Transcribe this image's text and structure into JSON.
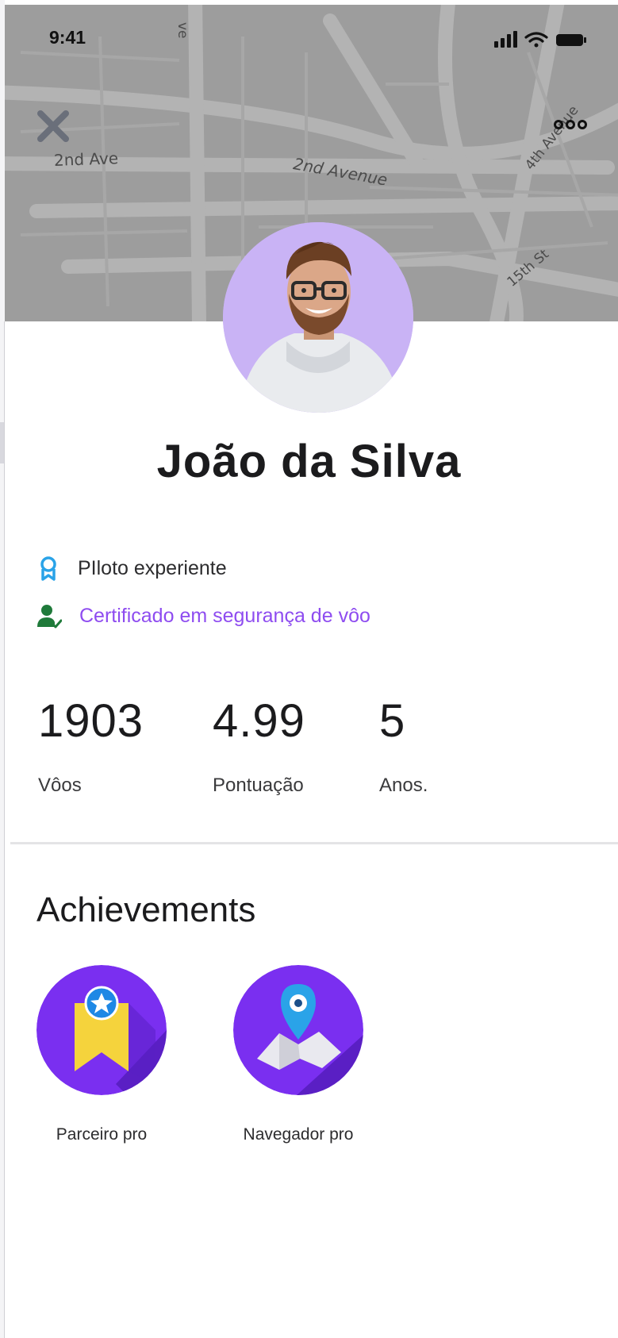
{
  "status_bar": {
    "time": "9:41"
  },
  "map": {
    "streets": [
      "2nd Ave",
      "2nd Avenue",
      "4th Avenue",
      "15th St",
      "ve"
    ]
  },
  "header": {
    "close_icon": "close-icon",
    "more_icon": "more-options-icon"
  },
  "profile": {
    "name": "João da Silva",
    "avatar_bg": "#c9b3f5",
    "badges": [
      {
        "icon": "ribbon-award-icon",
        "label": "PIloto experiente",
        "color": "#2aa3e8"
      },
      {
        "icon": "user-verified-icon",
        "label": "Certificado em segurança de vôo",
        "color": "#8e4cf0"
      }
    ]
  },
  "stats": [
    {
      "value": "1903",
      "label": "Vôos"
    },
    {
      "value": "4.99",
      "label": "Pontuação"
    },
    {
      "value": "5",
      "label": "Anos."
    }
  ],
  "achievements": {
    "title": "Achievements",
    "items": [
      {
        "icon": "bookmark-star-icon",
        "label": "Parceiro pro"
      },
      {
        "icon": "map-pin-icon",
        "label": "Navegador pro"
      }
    ]
  },
  "colors": {
    "accent": "#8e4cf0",
    "badge_bg": "#7a2ff0",
    "map_bg": "#9d9d9d"
  }
}
